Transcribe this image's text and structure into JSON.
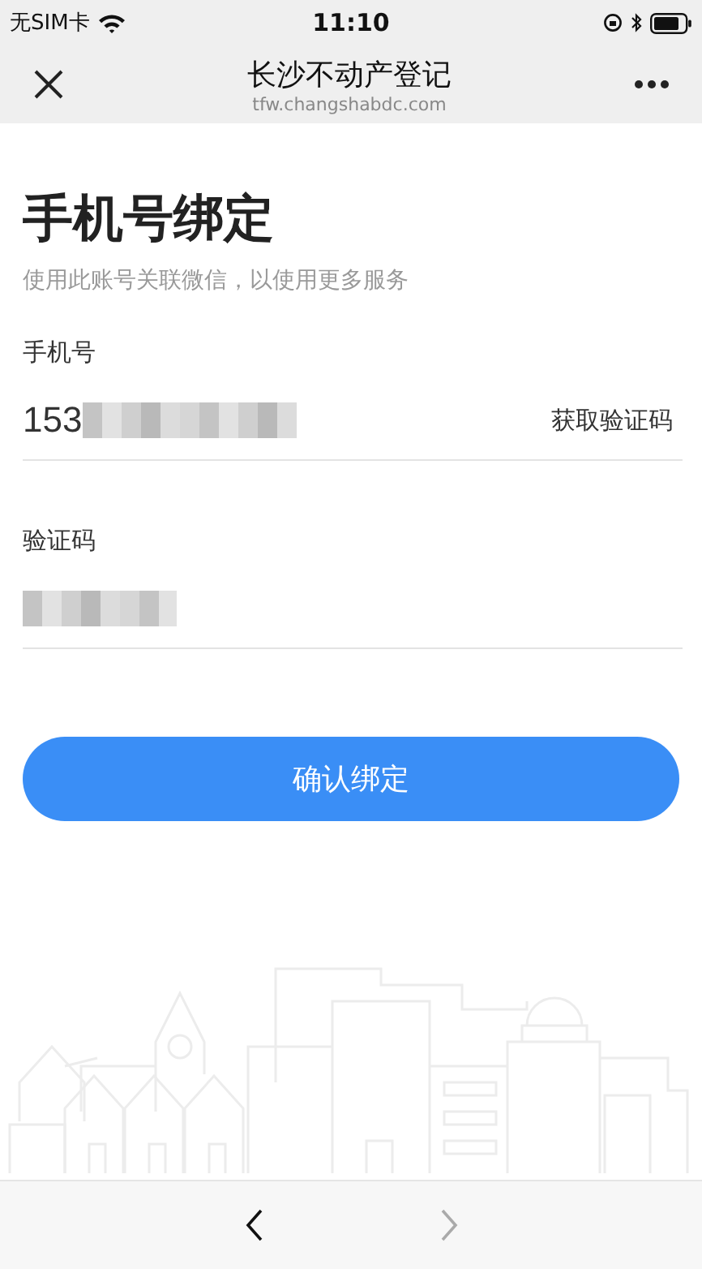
{
  "status_bar": {
    "carrier": "无SIM卡",
    "time": "11:10"
  },
  "nav_bar": {
    "title": "长沙不动产登记",
    "subtitle": "tfw.changshabdc.com"
  },
  "heading": "手机号绑定",
  "subheading": "使用此账号关联微信，以使用更多服务",
  "fields": [
    {
      "label": "手机号",
      "value": "153",
      "redacted": true,
      "action": "获取验证码"
    },
    {
      "label": "验证码",
      "redacted": true
    }
  ],
  "confirm_button": "确认绑定",
  "toolbar": [
    {
      "kind": "back",
      "disabled": false
    },
    {
      "kind": "forward",
      "disabled": true
    }
  ]
}
